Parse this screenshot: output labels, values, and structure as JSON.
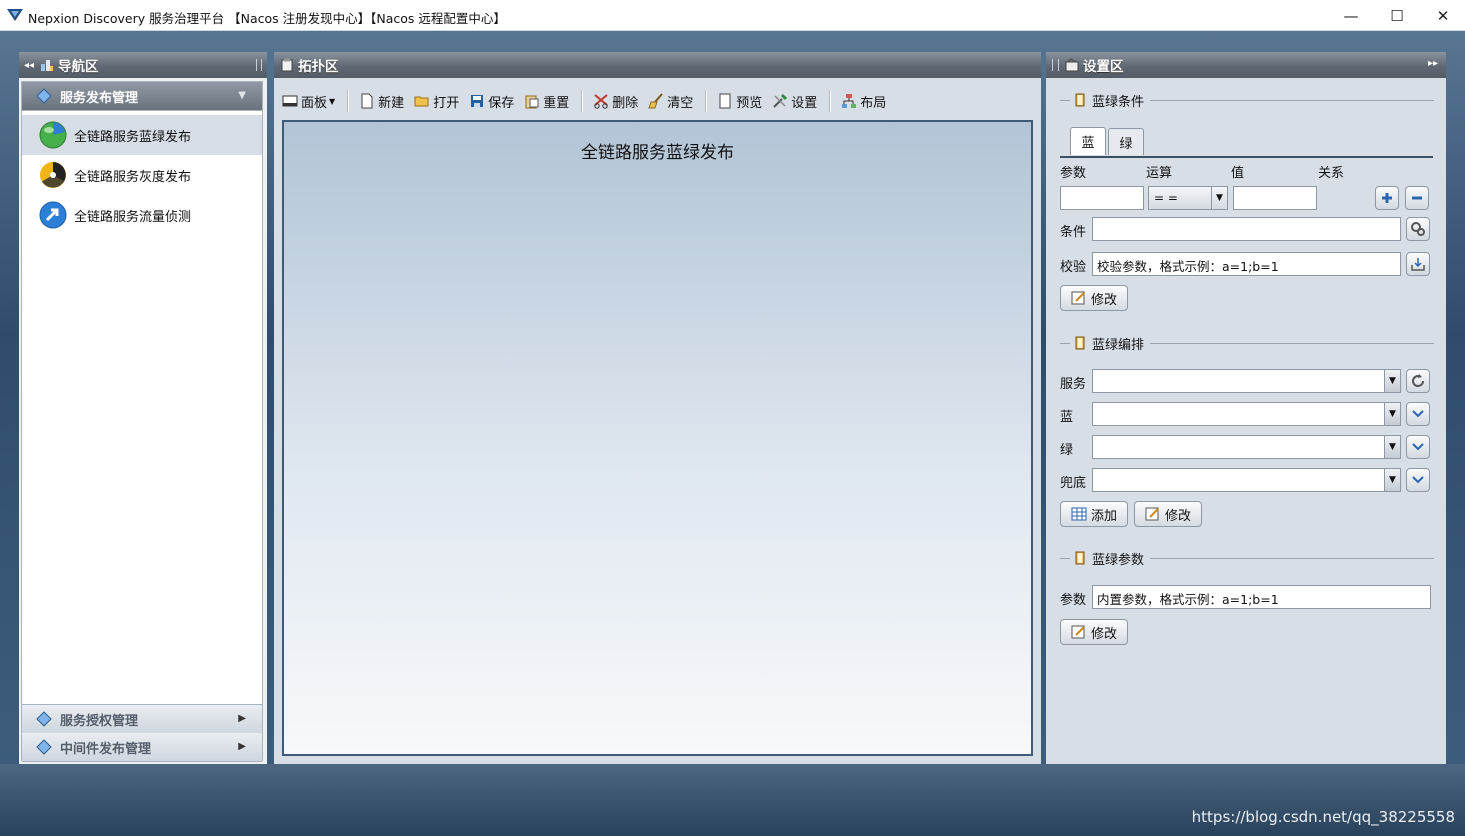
{
  "window": {
    "title": "Nepxion Discovery 服务治理平台 【Nacos 注册发现中心】【Nacos 远程配置中心】",
    "minimize": "—",
    "maximize": "☐",
    "close": "✕"
  },
  "nav": {
    "header": "导航区",
    "active_group": "服务发布管理",
    "items": [
      {
        "label": "全链路服务蓝绿发布",
        "icon": "green-orb-icon"
      },
      {
        "label": "全链路服务灰度发布",
        "icon": "radiation-icon"
      },
      {
        "label": "全链路服务流量侦测",
        "icon": "blue-arrow-icon"
      }
    ],
    "groups": [
      "服务授权管理",
      "中间件发布管理"
    ]
  },
  "topology": {
    "header": "拓扑区",
    "canvas_title": "全链路服务蓝绿发布",
    "toolbar": {
      "panel": "面板",
      "new": "新建",
      "open": "打开",
      "save": "保存",
      "reset": "重置",
      "delete": "删除",
      "clear": "清空",
      "preview": "预览",
      "settings": "设置",
      "layout": "布局"
    }
  },
  "settings": {
    "header": "设置区",
    "condition": {
      "title": "蓝绿条件",
      "tabs": [
        "蓝",
        "绿"
      ],
      "col_param": "参数",
      "col_op": "运算",
      "col_value": "值",
      "col_relation": "关系",
      "op_value": "= =",
      "cond_label": "条件",
      "verify_label": "校验",
      "verify_value": "校验参数，格式示例：a=1;b=1",
      "modify": "修改"
    },
    "arrange": {
      "title": "蓝绿编排",
      "service_label": "服务",
      "blue_label": "蓝",
      "green_label": "绿",
      "fallback_label": "兜底",
      "add": "添加",
      "modify": "修改"
    },
    "params": {
      "title": "蓝绿参数",
      "label": "参数",
      "value": "内置参数，格式示例：a=1;b=1",
      "modify": "修改"
    }
  },
  "watermark": "https://blog.csdn.net/qq_38225558"
}
